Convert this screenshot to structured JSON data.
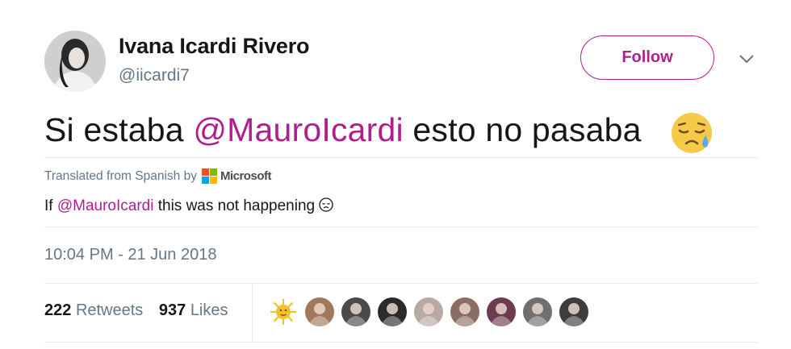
{
  "author": {
    "name": "Ivana Icardi Rivero",
    "handle": "@iicardi7",
    "avatar_icon": "profile-photo-icon"
  },
  "follow_label": "Follow",
  "tweet": {
    "text_before": "Si estaba ",
    "mention": "@MauroIcardi",
    "text_after": " esto no pasaba",
    "emoji": "sad-relieved-face-icon"
  },
  "translation": {
    "note": "Translated from Spanish by",
    "provider": "Microsoft",
    "prefix": "If ",
    "mention": "@MauroIcardi",
    "suffix": " this was not happening"
  },
  "timestamp": "10:04 PM - 21 Jun 2018",
  "stats": {
    "retweets_count": "222",
    "retweets_label": "Retweets",
    "likes_count": "937",
    "likes_label": "Likes"
  },
  "likers": [
    {
      "icon": "sun-avatar-icon",
      "color": "#f2c12e"
    },
    {
      "icon": "user-avatar-icon",
      "color": "#a1785a"
    },
    {
      "icon": "user-avatar-icon",
      "color": "#4a4a4a"
    },
    {
      "icon": "user-avatar-icon",
      "color": "#2b2b2b"
    },
    {
      "icon": "user-avatar-icon",
      "color": "#b8a9a2"
    },
    {
      "icon": "user-avatar-icon",
      "color": "#8a6e63"
    },
    {
      "icon": "user-avatar-icon",
      "color": "#6b3b4e"
    },
    {
      "icon": "user-avatar-icon",
      "color": "#6f6f6f"
    },
    {
      "icon": "user-avatar-icon",
      "color": "#3d3d3d"
    }
  ],
  "colors": {
    "accent": "#b01e8e",
    "secondary_text": "#657786",
    "divider": "#e6ecf0"
  }
}
